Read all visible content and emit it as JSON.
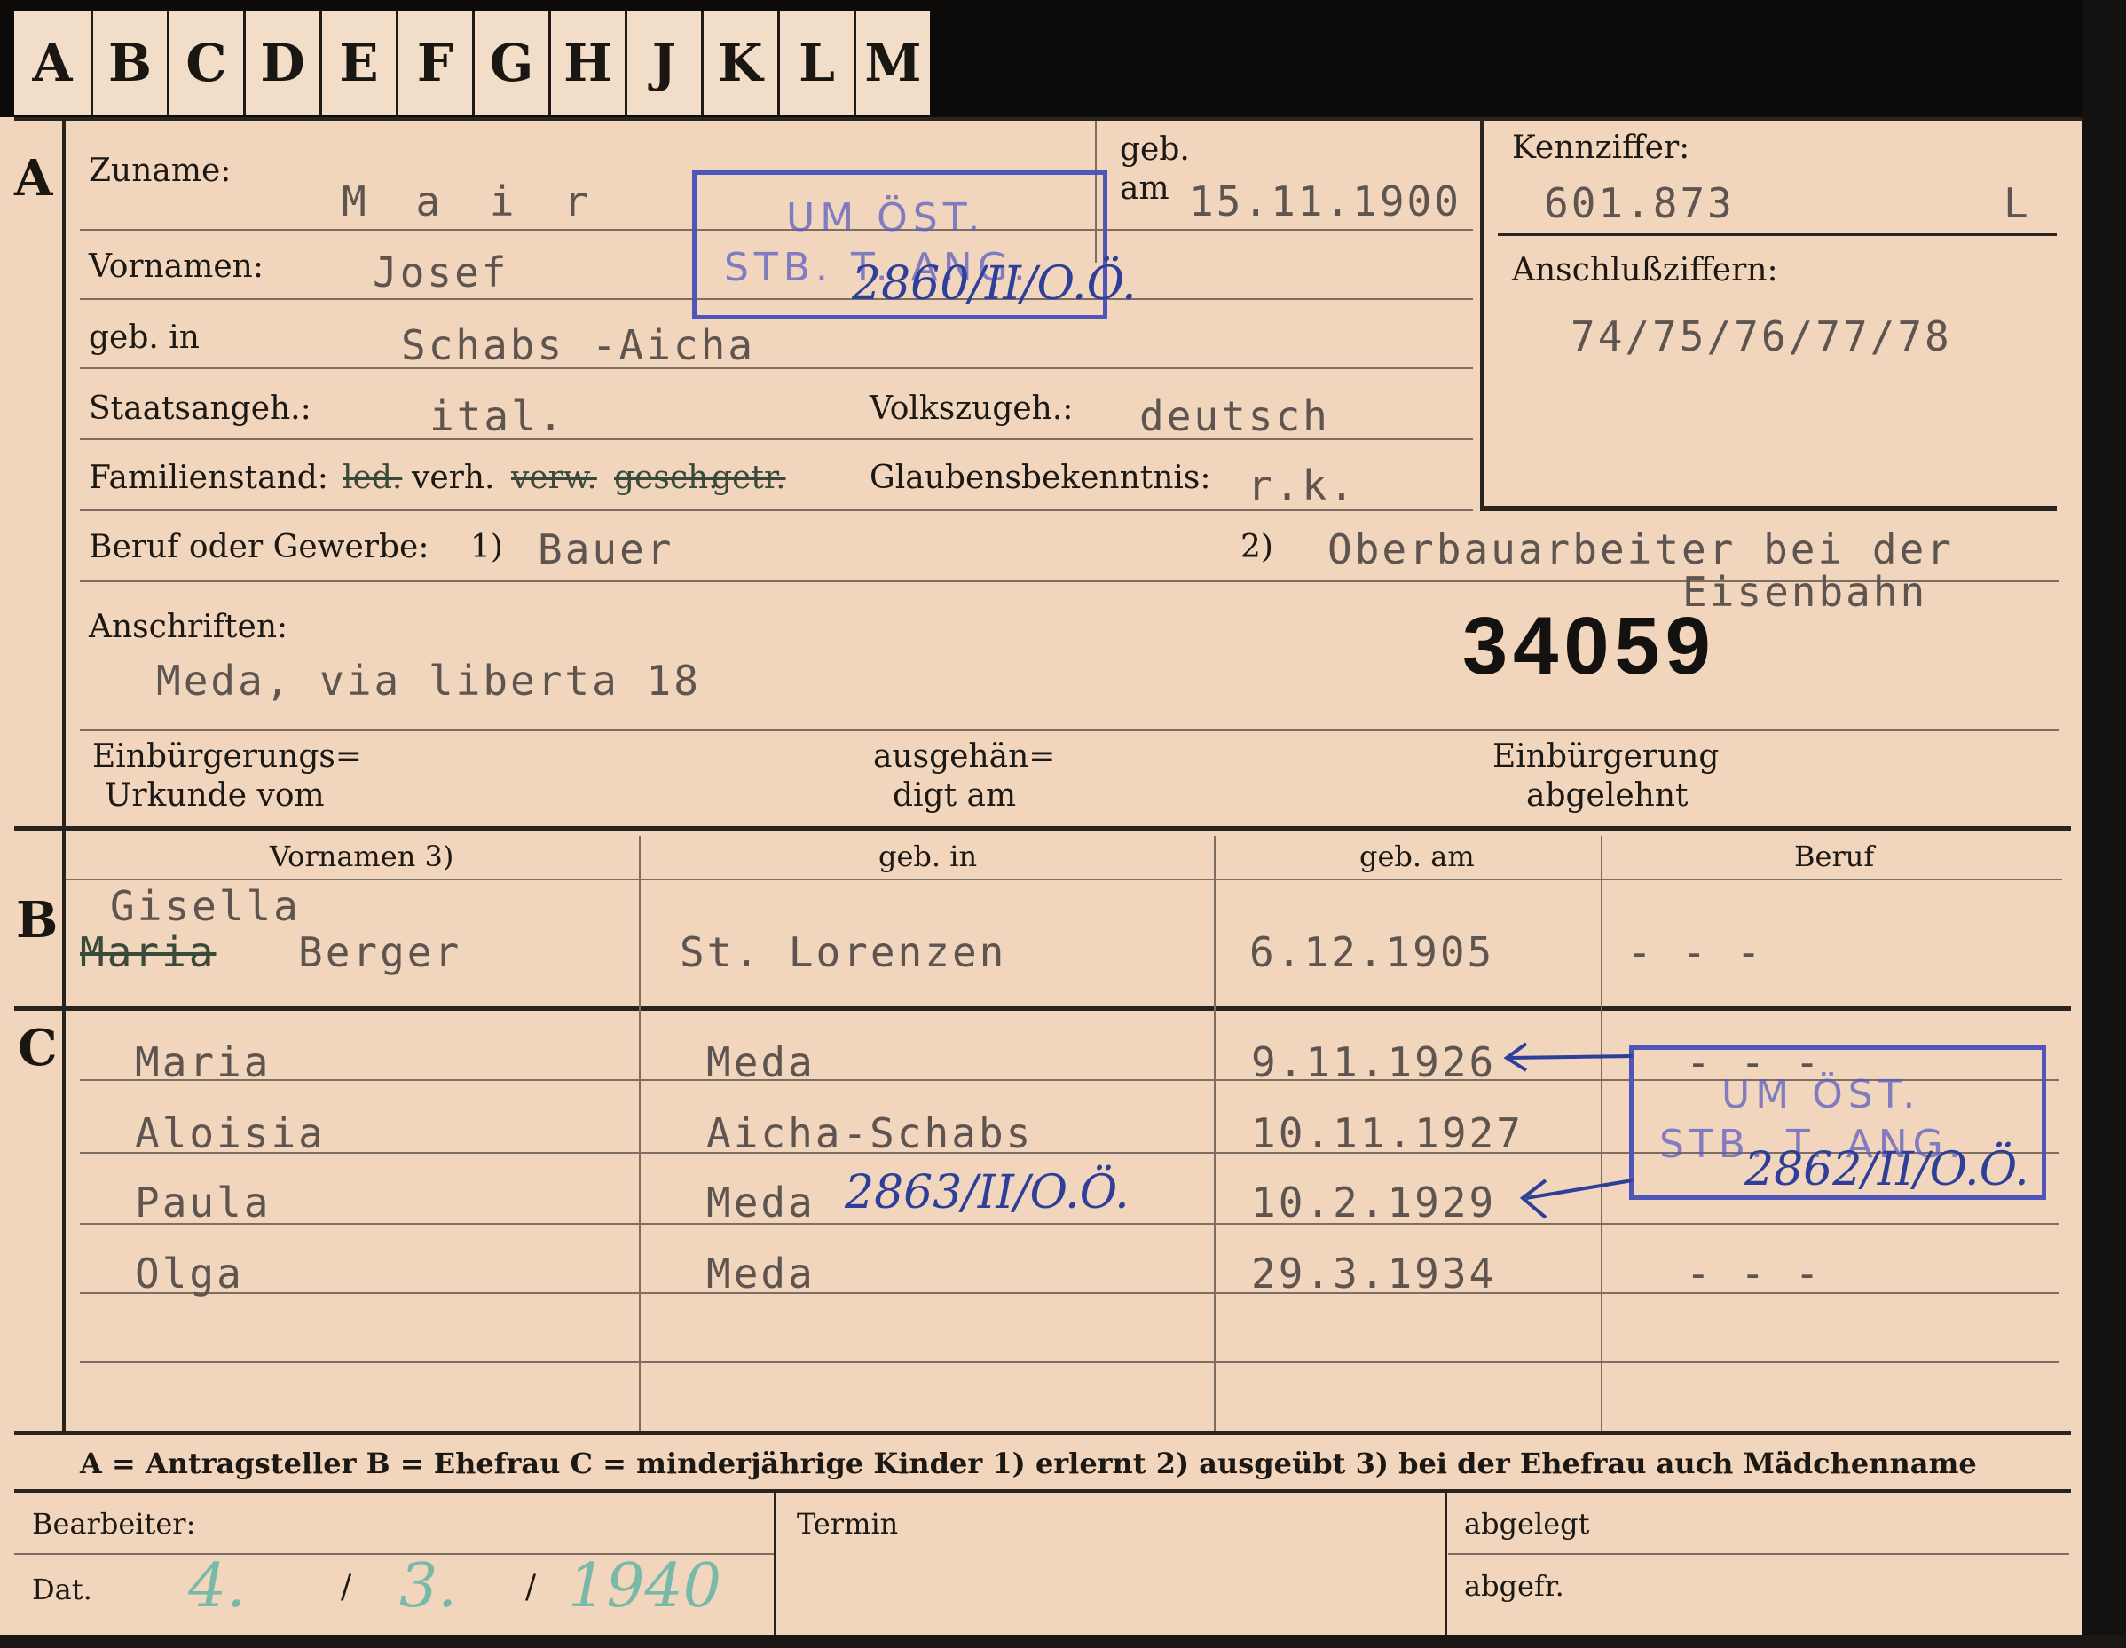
{
  "tabs": [
    "A",
    "B",
    "C",
    "D",
    "E",
    "F",
    "G",
    "H",
    "J",
    "K",
    "L",
    "M"
  ],
  "section_a": {
    "marker": "A",
    "surname_label": "Zuname:",
    "surname": "M a i r",
    "birth_label_1": "geb.",
    "birth_label_2": "am",
    "birth_date": "15.11.1900",
    "kennziffer_label": "Kennziffer:",
    "kennziffer": "601.873",
    "kennziffer_suffix": "L",
    "first_names_label": "Vornamen:",
    "first_names": "Josef",
    "anschluss_label": "Anschlußziffern:",
    "anschluss": "74/75/76/77/78",
    "birthplace_label": "geb. in",
    "birthplace": "Schabs -Aicha",
    "citizenship_label": "Staatsangeh.:",
    "citizenship": "ital.",
    "ethnicity_label": "Volkszugeh.:",
    "ethnicity": "deutsch",
    "family_label": "Familienstand:",
    "family_opt_ledig": "led.",
    "family_opt_verh": "verh.",
    "family_opt_verw": "verw.",
    "family_opt_gesch": "gesch.",
    "family_opt_getr": "getr.",
    "religion_label": "Glaubensbekenntnis:",
    "religion": "r.k.",
    "profession_label": "Beruf oder Gewerbe:",
    "profession_mark1": "1)",
    "profession_learned": "Bauer",
    "profession_mark2": "2)",
    "profession_practiced_1": "Oberbauarbeiter bei der",
    "profession_practiced_2": "Eisenbahn",
    "address_label": "Anschriften:",
    "address": "Meda, via liberta 18",
    "file_number": "34059",
    "naturalization_label_1": "Einbürgerungs=",
    "naturalization_label_2": "Urkunde vom",
    "handed_label_1": "ausgehän=",
    "handed_label_2": "digt am",
    "rejected_label_1": "Einbürgerung",
    "rejected_label_2": "abgelehnt"
  },
  "stamp_top": {
    "line1": "UM ÖST.",
    "line2": "STB. T. ANG.",
    "handwritten": "2860/II/O.Ö."
  },
  "section_b": {
    "marker": "B",
    "headers": [
      "Vornamen 3)",
      "geb. in",
      "geb. am",
      "Beruf"
    ],
    "first_name_1": "Gisella",
    "first_name_2": "Maria",
    "maiden_name": "Berger",
    "birthplace": "St. Lorenzen",
    "birth_date": "6.12.1905",
    "profession": "- - -"
  },
  "section_c": {
    "marker": "C",
    "children": [
      {
        "name": "Maria",
        "place": "Meda",
        "date": "9.11.1926",
        "job": "- - -"
      },
      {
        "name": "Aloisia",
        "place": "Aicha-Schabs",
        "date": "10.11.1927",
        "job": ""
      },
      {
        "name": "Paula",
        "place": "Meda",
        "date": "10.2.1929",
        "job": ""
      },
      {
        "name": "Olga",
        "place": "Meda",
        "date": "29.3.1934",
        "job": "- - -"
      }
    ],
    "handwritten_mid": "2863/II/O.Ö."
  },
  "stamp_right": {
    "line1": "UM ÖST.",
    "line2": "STB. T. ANG.",
    "handwritten": "2862/II/O.Ö."
  },
  "legend": "A = Antragsteller   B = Ehefrau   C = minderjährige Kinder   1) erlernt   2) ausgeübt   3) bei der Ehefrau auch Mädchenname",
  "footer": {
    "clerk_label": "Bearbeiter:",
    "date_label": "Dat.",
    "date_day": "4.",
    "date_month": "3.",
    "date_year": "1940",
    "sep": "/",
    "termin_label": "Termin",
    "filed_label": "abgelegt",
    "sent_label": "abgefr."
  },
  "colors": {
    "card": "#f1d5bd",
    "stamp": "#4f55b9",
    "ink": "#2d3f98",
    "green_ink": "#79b9a8",
    "type": "#5e5550"
  }
}
